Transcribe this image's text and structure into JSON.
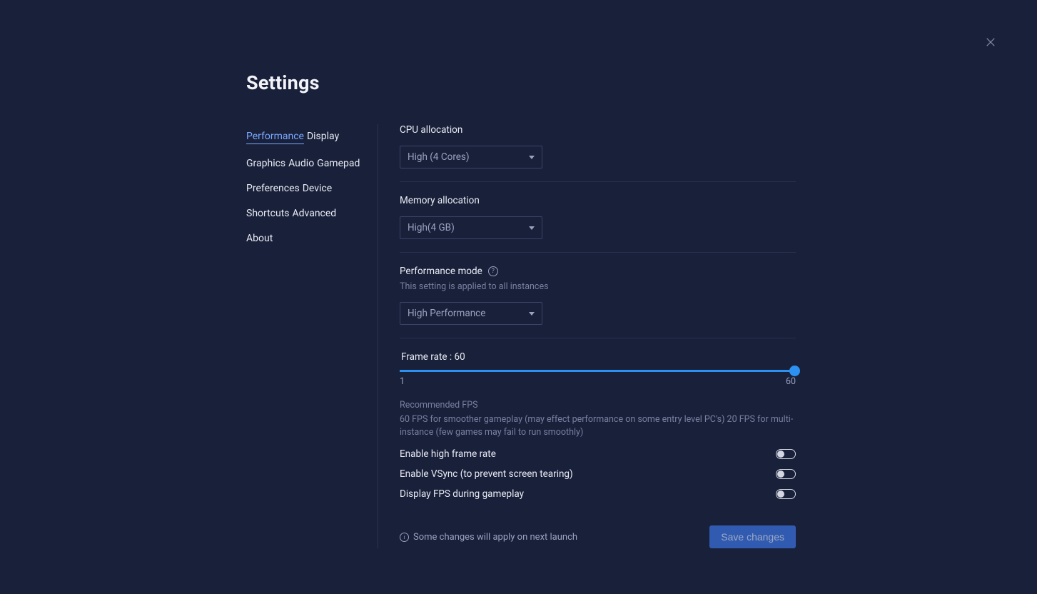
{
  "title": "Settings",
  "sidebar": {
    "items": [
      {
        "label": "Performance",
        "active": true
      },
      {
        "label": "Display"
      },
      {
        "label": "Graphics"
      },
      {
        "label": "Audio"
      },
      {
        "label": "Gamepad"
      },
      {
        "label": "Preferences"
      },
      {
        "label": "Device"
      },
      {
        "label": "Shortcuts"
      },
      {
        "label": "Advanced"
      },
      {
        "label": "About"
      }
    ]
  },
  "cpu": {
    "label": "CPU allocation",
    "value": "High (4 Cores)"
  },
  "memory": {
    "label": "Memory allocation",
    "value": "High(4 GB)"
  },
  "perfmode": {
    "label": "Performance mode",
    "sublabel": "This setting is applied to all instances",
    "value": "High Performance"
  },
  "framerate": {
    "label_prefix": "Frame rate : ",
    "value": 60,
    "min": 1,
    "max": 60,
    "rec_title": "Recommended FPS",
    "rec_body": "60 FPS for smoother gameplay (may effect performance on some entry level PC's) 20 FPS for multi-instance (few games may fail to run smoothly)"
  },
  "toggles": {
    "high_frame": {
      "label": "Enable high frame rate",
      "on": false
    },
    "vsync": {
      "label": "Enable VSync (to prevent screen tearing)",
      "on": false
    },
    "display_fps": {
      "label": "Display FPS during gameplay",
      "on": false
    }
  },
  "footer": {
    "info": "Some changes will apply on next launch",
    "save": "Save changes"
  }
}
